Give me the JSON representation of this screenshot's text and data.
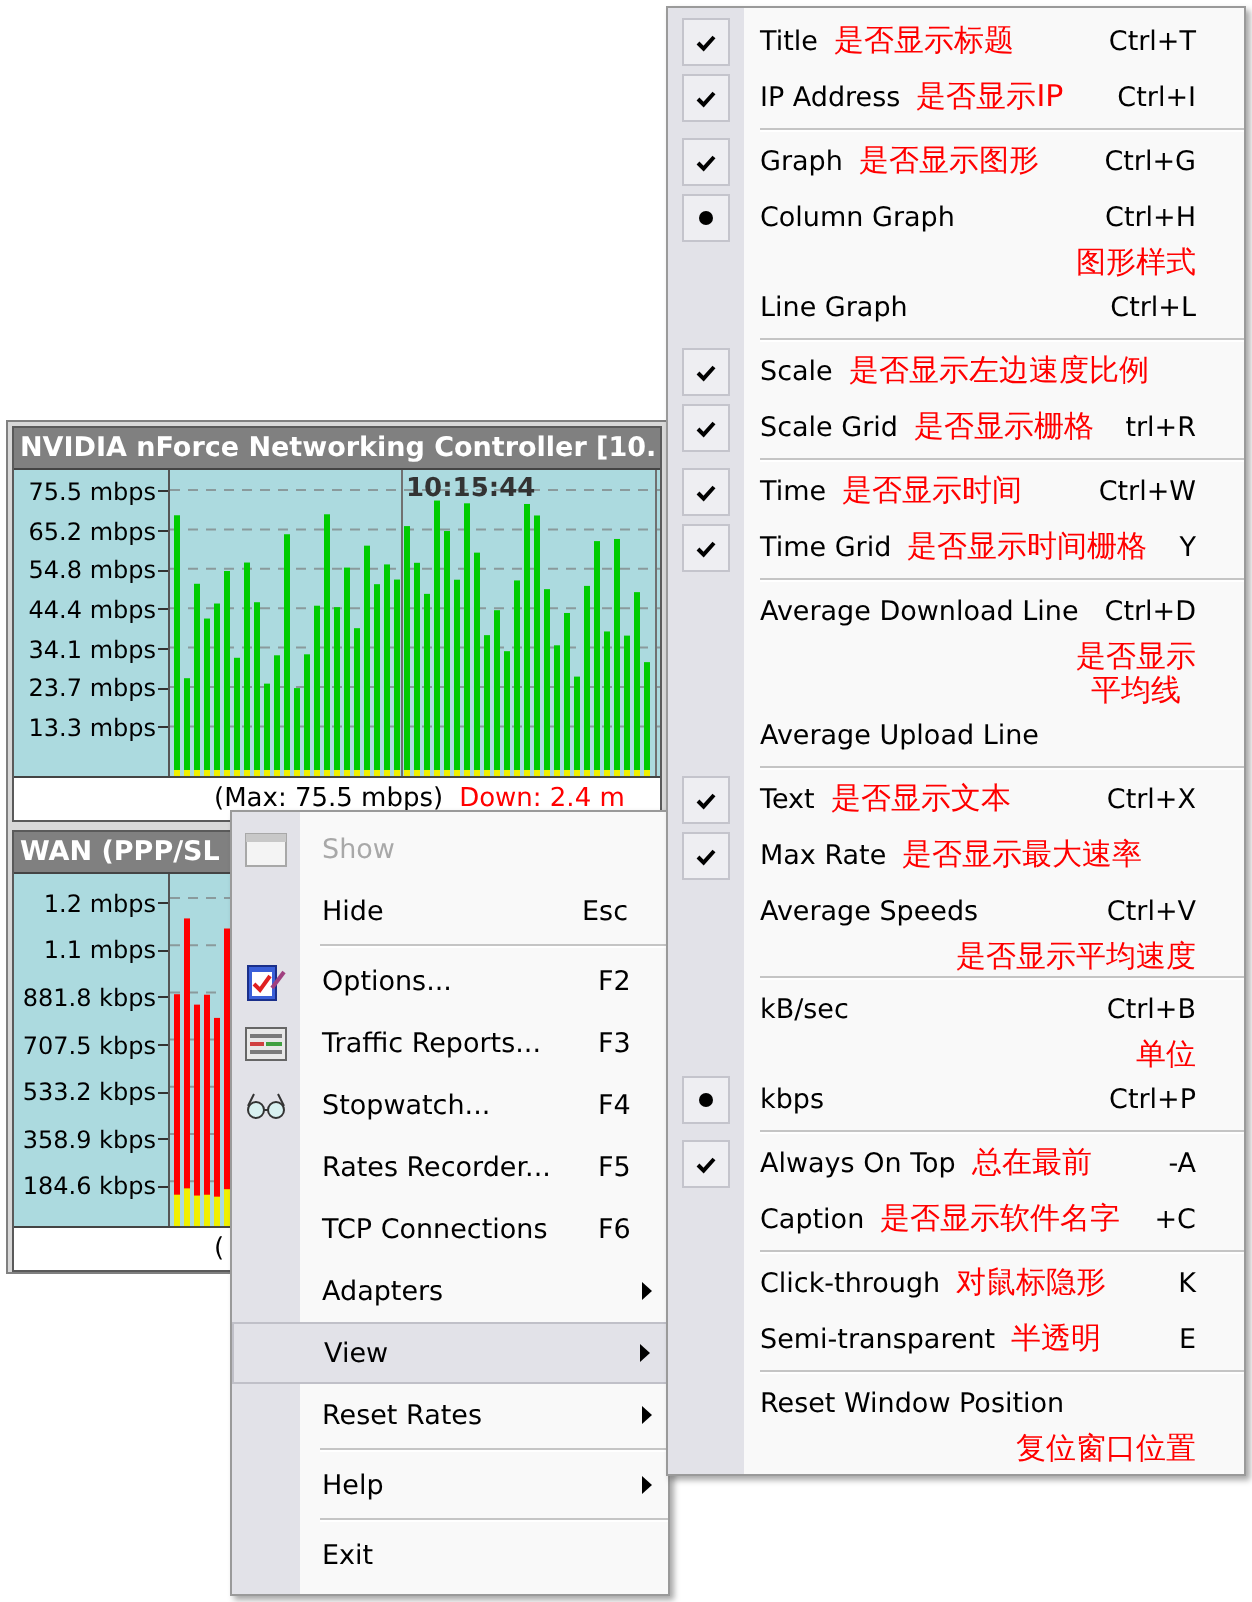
{
  "main_window": {
    "adapters": [
      {
        "title": "NVIDIA nForce Networking Controller [10.",
        "scale": [
          "75.5 mbps",
          "65.2 mbps",
          "54.8 mbps",
          "44.4 mbps",
          "34.1 mbps",
          "23.7 mbps",
          "13.3 mbps"
        ],
        "time_label": "10:15:44",
        "status_max": "(Max: 75.5 mbps)",
        "status_down": "Down: 2.4 m"
      },
      {
        "title": "WAN (PPP/SL",
        "scale": [
          "1.2 mbps",
          "1.1 mbps",
          "881.8 kbps",
          "707.5 kbps",
          "533.2 kbps",
          "358.9 kbps",
          "184.6 kbps"
        ],
        "status_max": "("
      }
    ]
  },
  "context_menu": {
    "items": [
      {
        "kind": "item",
        "label": "Show",
        "disabled": true,
        "selected": false,
        "has_submenu": false
      },
      {
        "kind": "item",
        "label": "Hide",
        "shortcut": "Esc",
        "disabled": false,
        "selected": false,
        "has_submenu": false
      },
      {
        "kind": "separator"
      },
      {
        "kind": "item",
        "label": "Options...",
        "shortcut": "F2",
        "disabled": false,
        "selected": false,
        "has_submenu": false
      },
      {
        "kind": "item",
        "label": "Traffic Reports...",
        "shortcut": "F3",
        "disabled": false,
        "selected": false,
        "has_submenu": false
      },
      {
        "kind": "item",
        "label": "Stopwatch...",
        "shortcut": "F4",
        "disabled": false,
        "selected": false,
        "has_submenu": false
      },
      {
        "kind": "item",
        "label": "Rates Recorder...",
        "shortcut": "F5",
        "disabled": false,
        "selected": false,
        "has_submenu": false
      },
      {
        "kind": "item",
        "label": "TCP Connections",
        "shortcut": "F6",
        "disabled": false,
        "selected": false,
        "has_submenu": false
      },
      {
        "kind": "item",
        "label": "Adapters",
        "disabled": false,
        "selected": false,
        "has_submenu": true
      },
      {
        "kind": "item",
        "label": "View",
        "disabled": false,
        "selected": true,
        "has_submenu": true
      },
      {
        "kind": "item",
        "label": "Reset Rates",
        "disabled": false,
        "selected": false,
        "has_submenu": true
      },
      {
        "kind": "separator"
      },
      {
        "kind": "item",
        "label": "Help",
        "disabled": false,
        "selected": false,
        "has_submenu": true
      },
      {
        "kind": "separator"
      },
      {
        "kind": "item",
        "label": "Exit",
        "disabled": false,
        "selected": false,
        "has_submenu": false
      }
    ]
  },
  "view_submenu": {
    "items": [
      {
        "kind": "check",
        "label": "Title",
        "checked": true,
        "note": "是否显示标题",
        "shortcut": "Ctrl+T"
      },
      {
        "kind": "check",
        "label": "IP Address",
        "checked": true,
        "note": "是否显示IP",
        "shortcut": "Ctrl+I"
      },
      {
        "kind": "separator"
      },
      {
        "kind": "check",
        "label": "Graph",
        "checked": true,
        "note": "是否显示图形",
        "shortcut": "Ctrl+G"
      },
      {
        "kind": "radio",
        "label": "Column Graph",
        "selected": true,
        "shortcut": "Ctrl+H"
      },
      {
        "kind": "note",
        "note": "图形样式"
      },
      {
        "kind": "radio",
        "label": "Line Graph",
        "selected": false,
        "shortcut": "Ctrl+L"
      },
      {
        "kind": "separator"
      },
      {
        "kind": "check",
        "label": "Scale",
        "checked": true,
        "note": "是否显示左边速度比例"
      },
      {
        "kind": "check",
        "label": "Scale Grid",
        "checked": true,
        "note": "是否显示栅格",
        "shortcut": "trl+R"
      },
      {
        "kind": "separator"
      },
      {
        "kind": "check",
        "label": "Time",
        "checked": true,
        "note": "是否显示时间",
        "shortcut": "Ctrl+W"
      },
      {
        "kind": "check",
        "label": "Time Grid",
        "checked": true,
        "note": "是否显示时间栅格",
        "shortcut": "Y"
      },
      {
        "kind": "separator"
      },
      {
        "kind": "check",
        "label": "Average Download Line",
        "checked": false,
        "shortcut": "Ctrl+D"
      },
      {
        "kind": "note",
        "note": "是否显示平均线"
      },
      {
        "kind": "check",
        "label": "Average Upload Line",
        "checked": false
      },
      {
        "kind": "separator"
      },
      {
        "kind": "check",
        "label": "Text",
        "checked": true,
        "note": "是否显示文本",
        "shortcut": "Ctrl+X"
      },
      {
        "kind": "check",
        "label": "Max Rate",
        "checked": true,
        "note": "是否显示最大速率"
      },
      {
        "kind": "check",
        "label": "Average Speeds",
        "checked": false,
        "shortcut": "Ctrl+V"
      },
      {
        "kind": "note",
        "note": "是否显示平均速度"
      },
      {
        "kind": "separator"
      },
      {
        "kind": "radio",
        "label": "kB/sec",
        "selected": false,
        "shortcut": "Ctrl+B"
      },
      {
        "kind": "note",
        "note": "单位"
      },
      {
        "kind": "radio",
        "label": "kbps",
        "selected": true,
        "shortcut": "Ctrl+P"
      },
      {
        "kind": "separator"
      },
      {
        "kind": "check",
        "label": "Always On Top",
        "checked": true,
        "note": "总在最前",
        "shortcut": "-A"
      },
      {
        "kind": "check",
        "label": "Caption",
        "checked": false,
        "note": "是否显示软件名字",
        "shortcut": "+C"
      },
      {
        "kind": "separator"
      },
      {
        "kind": "check",
        "label": "Click-through",
        "checked": false,
        "note": "对鼠标隐形",
        "shortcut": "K"
      },
      {
        "kind": "check",
        "label": "Semi-transparent",
        "checked": false,
        "note": "半透明",
        "shortcut": "E"
      },
      {
        "kind": "separator"
      },
      {
        "kind": "plain",
        "label": "Reset Window Position"
      },
      {
        "kind": "note",
        "note": "复位窗口位置"
      }
    ]
  }
}
